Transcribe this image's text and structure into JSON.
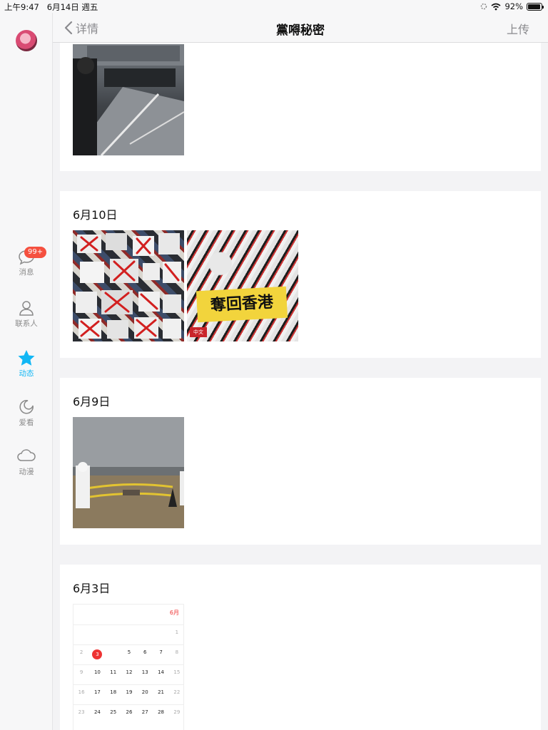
{
  "status_bar": {
    "time": "上午9:47",
    "date": "6月14日 週五",
    "battery": "92%",
    "battery_fraction": 0.92
  },
  "sidebar": {
    "items": [
      {
        "label": "消息",
        "icon": "chat-bubble-icon",
        "badge": "99+"
      },
      {
        "label": "联系人",
        "icon": "person-icon"
      },
      {
        "label": "动态",
        "icon": "star-icon",
        "active": true
      },
      {
        "label": "爱看",
        "icon": "moon-icon"
      },
      {
        "label": "动漫",
        "icon": "cloud-icon"
      }
    ]
  },
  "header": {
    "back_label": "详情",
    "title": "黨嘚秘密",
    "upload_label": "上传"
  },
  "feed": {
    "entries": [
      {
        "date": "6月10日",
        "photo_text": {
          "banner": "奪回香港",
          "tag": "中文"
        }
      },
      {
        "date": "6月9日"
      },
      {
        "date": "6月3日",
        "calendar": {
          "month": "6月",
          "today": "3"
        }
      }
    ]
  },
  "colors": {
    "accent": "#12b7f5",
    "badge": "#f5503f"
  }
}
